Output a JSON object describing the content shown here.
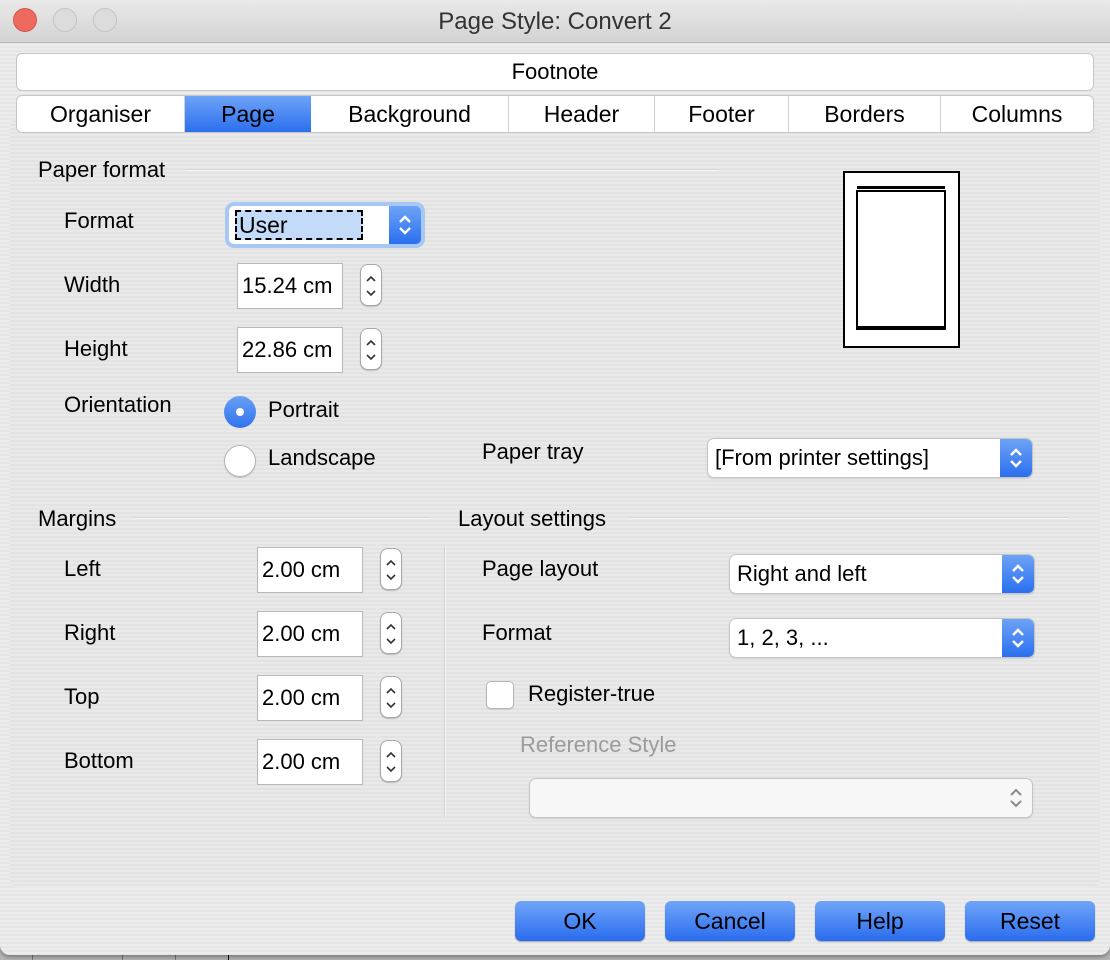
{
  "window": {
    "title": "Page Style: Convert 2",
    "controls": [
      "close",
      "minimize",
      "zoom"
    ]
  },
  "tabs_row1": [
    {
      "label": "Footnote",
      "active": false
    }
  ],
  "tabs_row2": [
    {
      "label": "Organiser",
      "active": false
    },
    {
      "label": "Page",
      "active": true
    },
    {
      "label": "Background",
      "active": false
    },
    {
      "label": "Header",
      "active": false
    },
    {
      "label": "Footer",
      "active": false
    },
    {
      "label": "Borders",
      "active": false
    },
    {
      "label": "Columns",
      "active": false
    }
  ],
  "paper_format": {
    "section_title": "Paper format",
    "format_label": "Format",
    "format_value": "User",
    "width_label": "Width",
    "width_value": "15.24 cm",
    "height_label": "Height",
    "height_value": "22.86 cm",
    "orientation_label": "Orientation",
    "orientation_options": [
      {
        "label": "Portrait",
        "selected": true
      },
      {
        "label": "Landscape",
        "selected": false
      }
    ],
    "paper_tray_label": "Paper tray",
    "paper_tray_value": "[From printer settings]"
  },
  "margins": {
    "section_title": "Margins",
    "left_label": "Left",
    "left_value": "2.00 cm",
    "right_label": "Right",
    "right_value": "2.00 cm",
    "top_label": "Top",
    "top_value": "2.00 cm",
    "bottom_label": "Bottom",
    "bottom_value": "2.00 cm"
  },
  "layout_settings": {
    "section_title": "Layout settings",
    "page_layout_label": "Page layout",
    "page_layout_value": "Right and left",
    "format_label": "Format",
    "format_value": "1, 2, 3, ...",
    "register_true_label": "Register-true",
    "register_true_checked": false,
    "reference_style_label": "Reference Style",
    "reference_style_value": ""
  },
  "buttons": {
    "ok": "OK",
    "cancel": "Cancel",
    "help": "Help",
    "reset": "Reset"
  },
  "colors": {
    "accent": "#2b6ff0",
    "close_button": "#ed6a5e"
  }
}
